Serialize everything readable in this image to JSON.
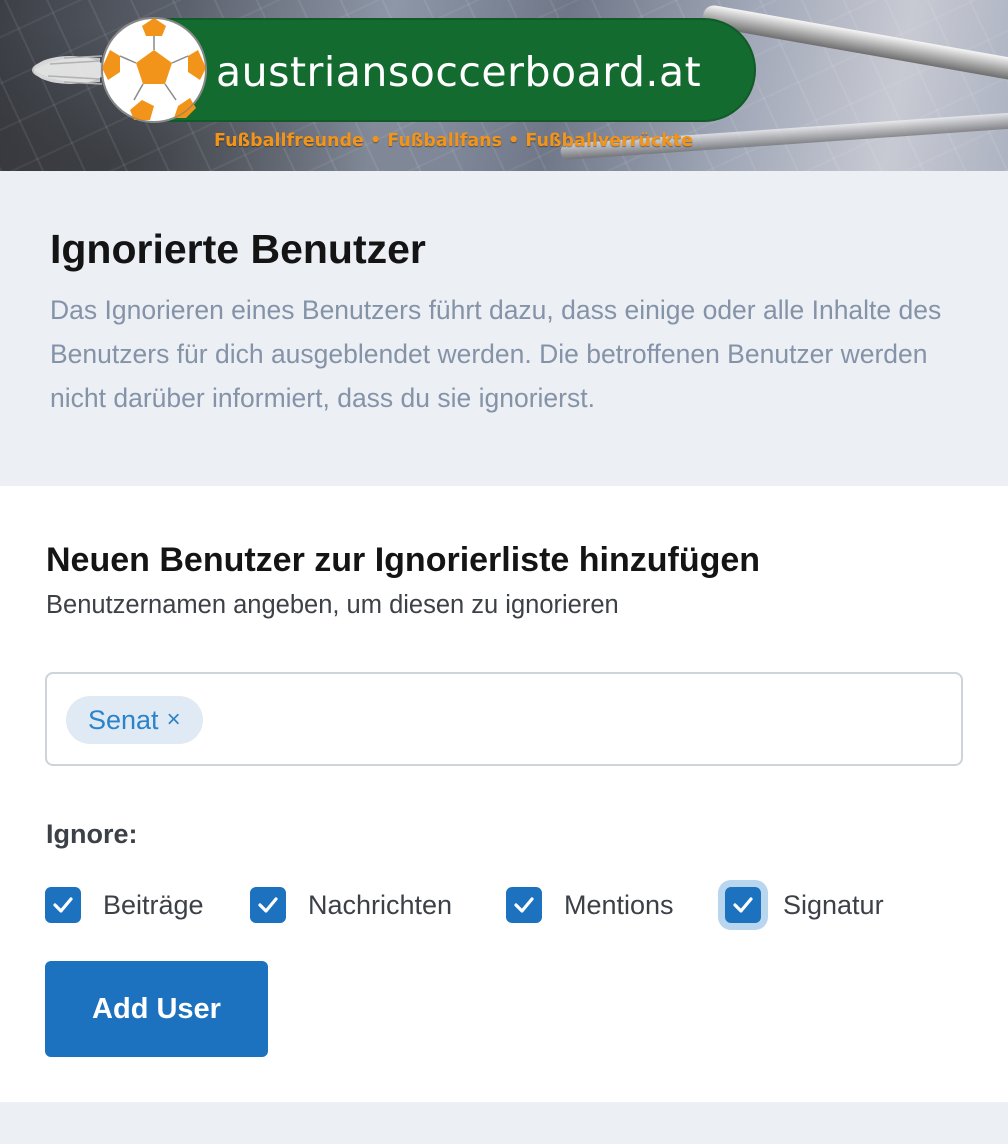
{
  "banner": {
    "brand": "austriansoccerboard.at",
    "tagline": "Fußballfreunde • Fußballfans • Fußballverrückte",
    "colors": {
      "pill": "#136b2f",
      "tagline": "#f29419",
      "ball_accent": "#f29419"
    }
  },
  "header": {
    "title": "Ignorierte Benutzer",
    "description": "Das Ignorieren eines Benutzers führt dazu, dass einige oder alle Inhalte des Benutzers für dich ausgeblendet werden. Die betroffenen Benutzer werden nicht darüber informiert, dass du sie ignorierst."
  },
  "form": {
    "title": "Neuen Benutzer zur Ignorierliste hinzufügen",
    "subtitle": "Benutzernamen angeben, um diesen zu ignorieren",
    "selected_users": [
      {
        "name": "Senat",
        "remove_symbol": "×"
      }
    ],
    "ignore_label": "Ignore:",
    "options": [
      {
        "label": "Beiträge",
        "checked": true,
        "icon": "checkmark-icon"
      },
      {
        "label": "Nachrichten",
        "checked": true,
        "icon": "checkmark-icon"
      },
      {
        "label": "Mentions",
        "checked": true,
        "icon": "checkmark-icon"
      },
      {
        "label": "Signatur",
        "checked": true,
        "focused": true,
        "icon": "checkmark-icon"
      }
    ],
    "submit_label": "Add User"
  },
  "theme": {
    "accent": "#1d72bf",
    "chip_bg": "#dfeaf5",
    "chip_text": "#2b83c9",
    "muted_text": "#8593a8",
    "page_bg": "#eceff4"
  }
}
